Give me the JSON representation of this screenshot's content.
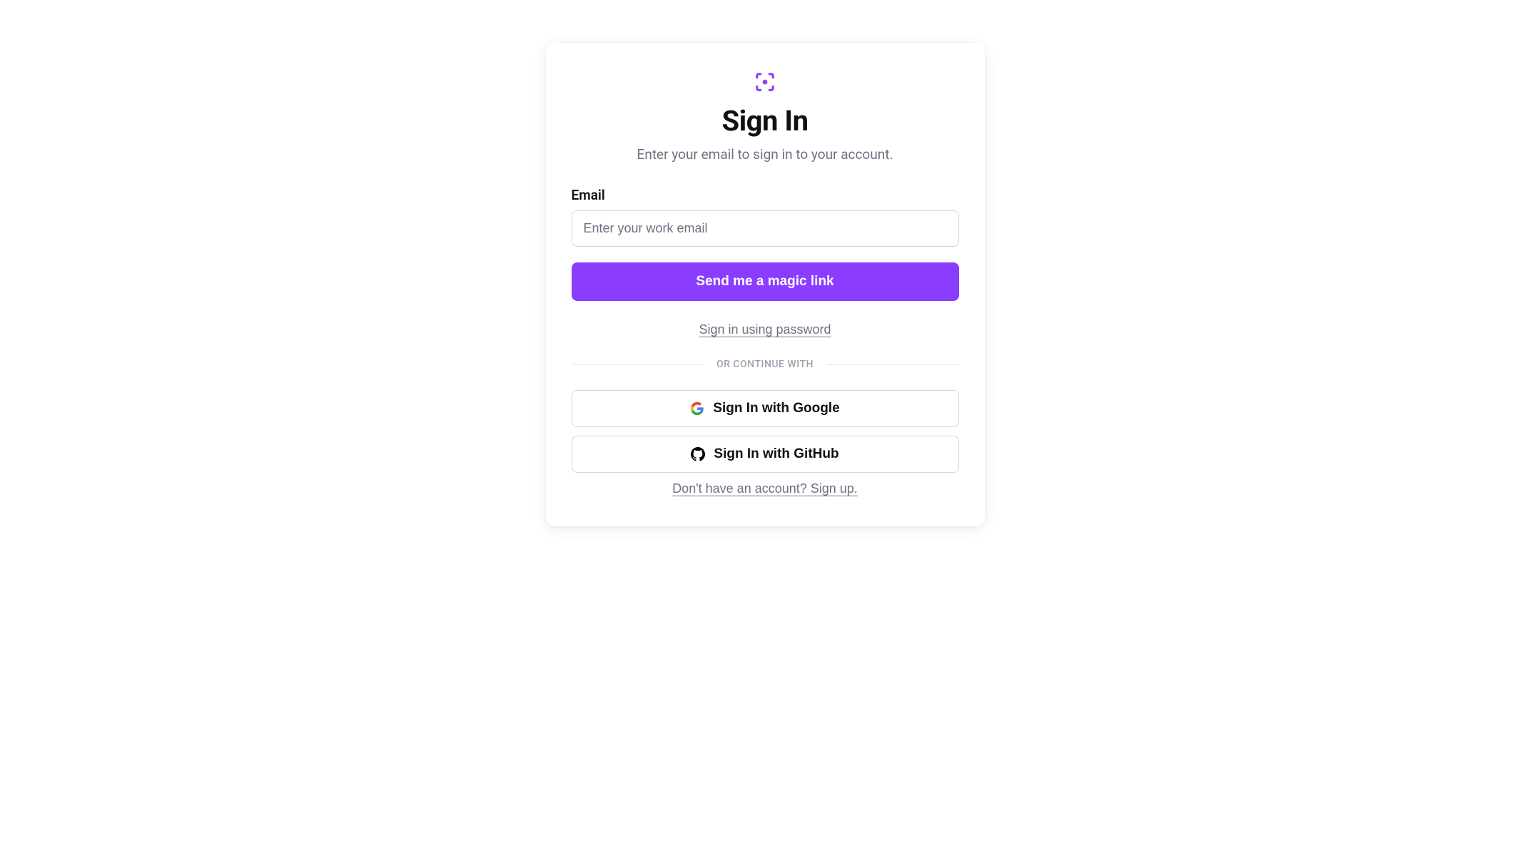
{
  "header": {
    "title": "Sign In",
    "subtitle": "Enter your email to sign in to your account."
  },
  "form": {
    "email_label": "Email",
    "email_placeholder": "Enter your work email",
    "email_value": ""
  },
  "actions": {
    "magic_link_label": "Send me a magic link",
    "password_link_label": "Sign in using password"
  },
  "divider": {
    "text": "OR CONTINUE WITH"
  },
  "oauth": {
    "google_label": "Sign In with Google",
    "github_label": "Sign In with GitHub"
  },
  "footer": {
    "signup_link": "Don't have an account? Sign up."
  },
  "colors": {
    "primary": "#8b3dff"
  }
}
